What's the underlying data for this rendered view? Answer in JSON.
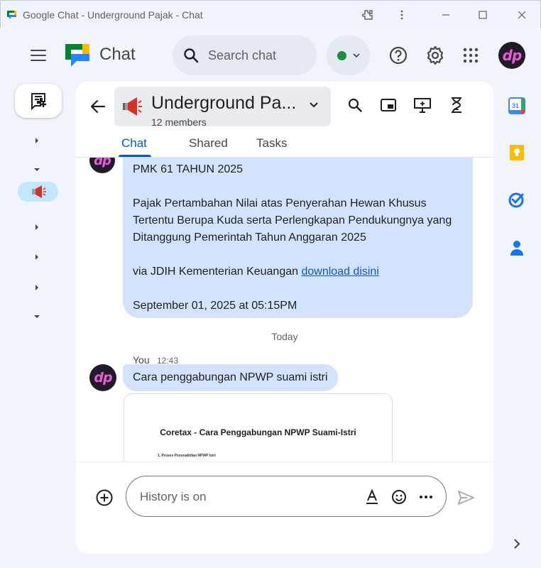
{
  "window": {
    "title": "Google Chat - Underground Pajak - Chat"
  },
  "header": {
    "app_name": "Chat",
    "search_placeholder": "Search chat",
    "status": "active",
    "icons": [
      "menu-icon",
      "help-icon",
      "settings-icon",
      "apps-grid-icon",
      "account-avatar"
    ],
    "avatar_text": "dp"
  },
  "rail": {
    "new_chat_icon": "new-chat-icon",
    "active_space_icon": "megaphone-icon"
  },
  "space": {
    "name": "Underground Pa...",
    "members": "12 members",
    "tabs": [
      {
        "label": "Chat",
        "active": true
      },
      {
        "label": "Shared",
        "active": false
      },
      {
        "label": "Tasks",
        "active": false
      }
    ]
  },
  "messages": {
    "post": {
      "title": "PMK 61 TAHUN 2025",
      "body": "Pajak Pertambahan Nilai atas Penyerahan Hewan Khusus Tertentu Berupa Kuda serta Perlengkapan Pendukungnya yang Ditanggung Pemerintah Tahun Anggaran 2025",
      "via": "via JDIH Kementerian Keuangan ",
      "link_text": "download disini",
      "date": "September 01, 2025 at 05:15PM"
    },
    "date_divider": "Today",
    "mine": {
      "author": "You",
      "time": "12:43",
      "text": "Cara penggabungan NPWP suami istri",
      "attachment_title": "Coretax - Cara Penggabungan NPWP Suami-Istri",
      "attachment_line": "1.      Proses Penonaktifan NPWP Istri"
    }
  },
  "composer": {
    "placeholder": "History is on"
  },
  "side_panel": {
    "icons": [
      "calendar-icon",
      "keep-icon",
      "tasks-icon",
      "contacts-icon"
    ],
    "calendar_day": "31"
  },
  "colors": {
    "accent": "#0b57d0",
    "bubble": "#d3e3fd",
    "active_nav": "#c2e7ff",
    "status_green": "#1e8e3e"
  }
}
